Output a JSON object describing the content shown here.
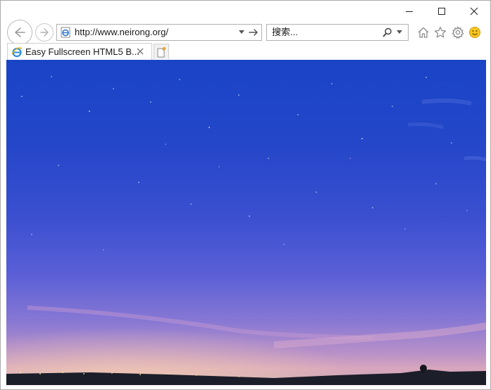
{
  "window": {
    "caption_buttons": [
      "minimize",
      "maximize",
      "close"
    ]
  },
  "address_bar": {
    "url": "http://www.neirong.org/"
  },
  "search": {
    "placeholder": "搜索..."
  },
  "tabs": [
    {
      "title": "Easy Fullscreen HTML5 B...",
      "active": true
    }
  ],
  "toolbar_icons": [
    "home-icon",
    "favorites-star-icon",
    "tools-gear-icon",
    "feedback-smiley-icon"
  ],
  "content": {
    "type": "fullscreen background image",
    "scene": "night sky over horizon with town lights",
    "colors": {
      "sky_top": "#1a44c6",
      "sky_mid": "#3a4fd0",
      "horizon_glow": "#d8a6bd",
      "ground": "#1c1e2a"
    }
  }
}
